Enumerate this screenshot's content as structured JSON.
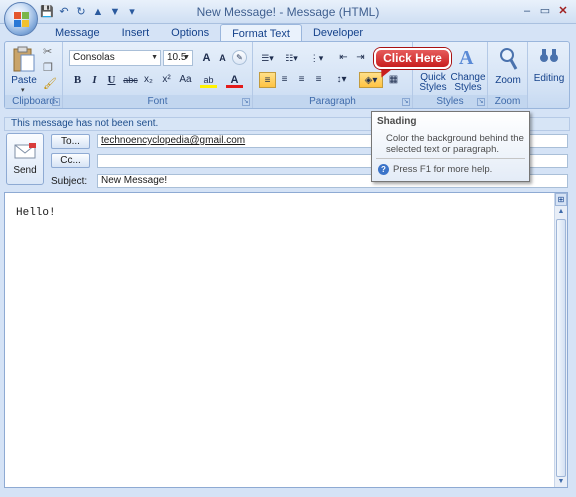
{
  "window": {
    "title": "New Message! - Message (HTML)",
    "minimize": "–",
    "maximize": "▭",
    "close": "✕"
  },
  "qat": [
    "💾",
    "↶",
    "↻",
    "▲",
    "▼",
    "▾"
  ],
  "tabs": [
    "Message",
    "Insert",
    "Options",
    "Format Text",
    "Developer"
  ],
  "active_tab": "Format Text",
  "ribbon": {
    "clipboard": {
      "label": "Clipboard",
      "paste": "Paste"
    },
    "font": {
      "label": "Font",
      "family": "Consolas",
      "size": "10.5",
      "bold": "B",
      "italic": "I",
      "underline": "U",
      "strike": "abc",
      "sub": "x₂",
      "sup": "x²",
      "case": "Aa",
      "grow": "A",
      "shrink": "A",
      "highlight": "ab",
      "color": "A"
    },
    "paragraph": {
      "label": "Paragraph"
    },
    "styles": {
      "label": "Styles",
      "quick": "Quick Styles",
      "change": "Change Styles"
    },
    "zoom": {
      "label": "Zoom",
      "button": "Zoom"
    },
    "editing": {
      "label": "Editing"
    }
  },
  "callout": "Click Here",
  "info_bar": "This message has not been sent.",
  "header": {
    "send": "Send",
    "to_button": "To...",
    "to_value": "technoencyclopedia@gmail.com",
    "cc_button": "Cc...",
    "cc_value": "",
    "subject_label": "Subject:",
    "subject_value": "New Message!"
  },
  "tooltip": {
    "title": "Shading",
    "description": "Color the background behind the selected text or paragraph.",
    "help": "Press F1 for more help."
  },
  "body_text": "Hello!"
}
